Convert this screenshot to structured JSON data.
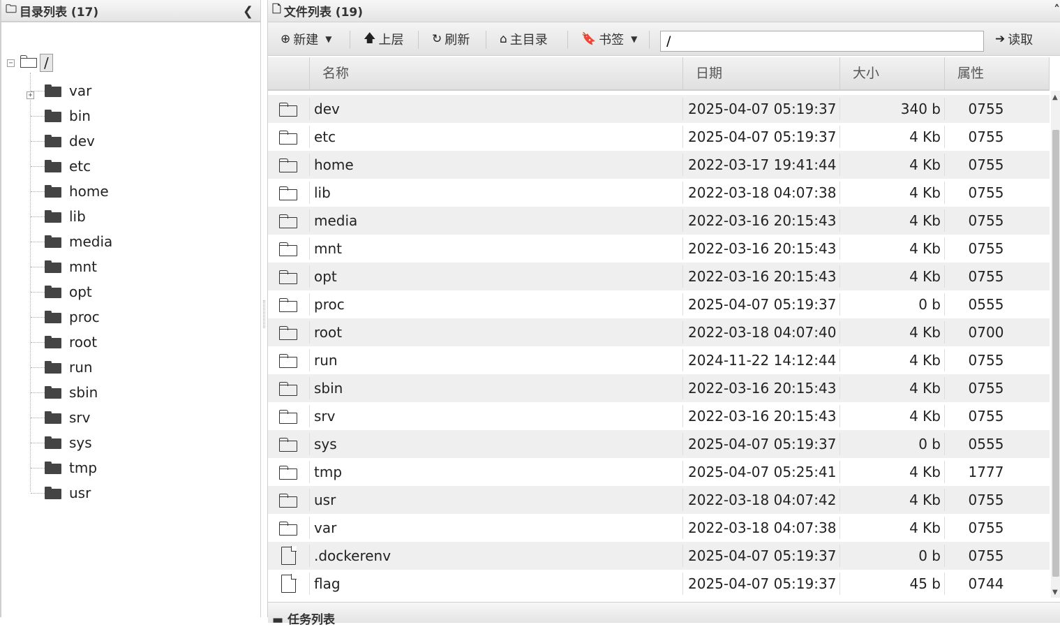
{
  "left_panel": {
    "title": "目录列表 (17)",
    "collapse_icon": "chevron-left-icon",
    "tree": {
      "root_label": "/",
      "root_expander": "−",
      "items": [
        {
          "name": "var",
          "expandable": true
        },
        {
          "name": "bin"
        },
        {
          "name": "dev"
        },
        {
          "name": "etc"
        },
        {
          "name": "home"
        },
        {
          "name": "lib"
        },
        {
          "name": "media"
        },
        {
          "name": "mnt"
        },
        {
          "name": "opt"
        },
        {
          "name": "proc"
        },
        {
          "name": "root"
        },
        {
          "name": "run"
        },
        {
          "name": "sbin"
        },
        {
          "name": "srv"
        },
        {
          "name": "sys"
        },
        {
          "name": "tmp"
        },
        {
          "name": "usr"
        }
      ]
    }
  },
  "right_panel": {
    "title": "文件列表 (19)",
    "collapse_icon": "chevron-up-icon",
    "toolbar": {
      "new_label": "新建",
      "up_label": "上层",
      "refresh_label": "刷新",
      "home_label": "主目录",
      "bookmark_label": "书签",
      "path_value": "/",
      "read_label": "读取"
    },
    "columns": [
      "名称",
      "日期",
      "大小",
      "属性"
    ],
    "rows": [
      {
        "type": "folder",
        "name": "dev",
        "date": "2025-04-07 05:19:37",
        "size": "340 b",
        "attr": "0755"
      },
      {
        "type": "folder",
        "name": "etc",
        "date": "2025-04-07 05:19:37",
        "size": "4 Kb",
        "attr": "0755"
      },
      {
        "type": "folder",
        "name": "home",
        "date": "2022-03-17 19:41:44",
        "size": "4 Kb",
        "attr": "0755"
      },
      {
        "type": "folder",
        "name": "lib",
        "date": "2022-03-18 04:07:38",
        "size": "4 Kb",
        "attr": "0755"
      },
      {
        "type": "folder",
        "name": "media",
        "date": "2022-03-16 20:15:43",
        "size": "4 Kb",
        "attr": "0755"
      },
      {
        "type": "folder",
        "name": "mnt",
        "date": "2022-03-16 20:15:43",
        "size": "4 Kb",
        "attr": "0755"
      },
      {
        "type": "folder",
        "name": "opt",
        "date": "2022-03-16 20:15:43",
        "size": "4 Kb",
        "attr": "0755"
      },
      {
        "type": "folder",
        "name": "proc",
        "date": "2025-04-07 05:19:37",
        "size": "0 b",
        "attr": "0555"
      },
      {
        "type": "folder",
        "name": "root",
        "date": "2022-03-18 04:07:40",
        "size": "4 Kb",
        "attr": "0700"
      },
      {
        "type": "folder",
        "name": "run",
        "date": "2024-11-22 14:12:44",
        "size": "4 Kb",
        "attr": "0755"
      },
      {
        "type": "folder",
        "name": "sbin",
        "date": "2022-03-16 20:15:43",
        "size": "4 Kb",
        "attr": "0755"
      },
      {
        "type": "folder",
        "name": "srv",
        "date": "2022-03-16 20:15:43",
        "size": "4 Kb",
        "attr": "0755"
      },
      {
        "type": "folder",
        "name": "sys",
        "date": "2025-04-07 05:19:37",
        "size": "0 b",
        "attr": "0555"
      },
      {
        "type": "folder",
        "name": "tmp",
        "date": "2025-04-07 05:25:41",
        "size": "4 Kb",
        "attr": "1777"
      },
      {
        "type": "folder",
        "name": "usr",
        "date": "2022-03-18 04:07:42",
        "size": "4 Kb",
        "attr": "0755"
      },
      {
        "type": "folder",
        "name": "var",
        "date": "2022-03-18 04:07:38",
        "size": "4 Kb",
        "attr": "0755"
      },
      {
        "type": "file",
        "name": ".dockerenv",
        "date": "2025-04-07 05:19:37",
        "size": "0 b",
        "attr": "0755"
      },
      {
        "type": "file",
        "name": "flag",
        "date": "2025-04-07 05:19:37",
        "size": "45 b",
        "attr": "0744"
      }
    ]
  },
  "task_panel": {
    "title": "任务列表"
  }
}
